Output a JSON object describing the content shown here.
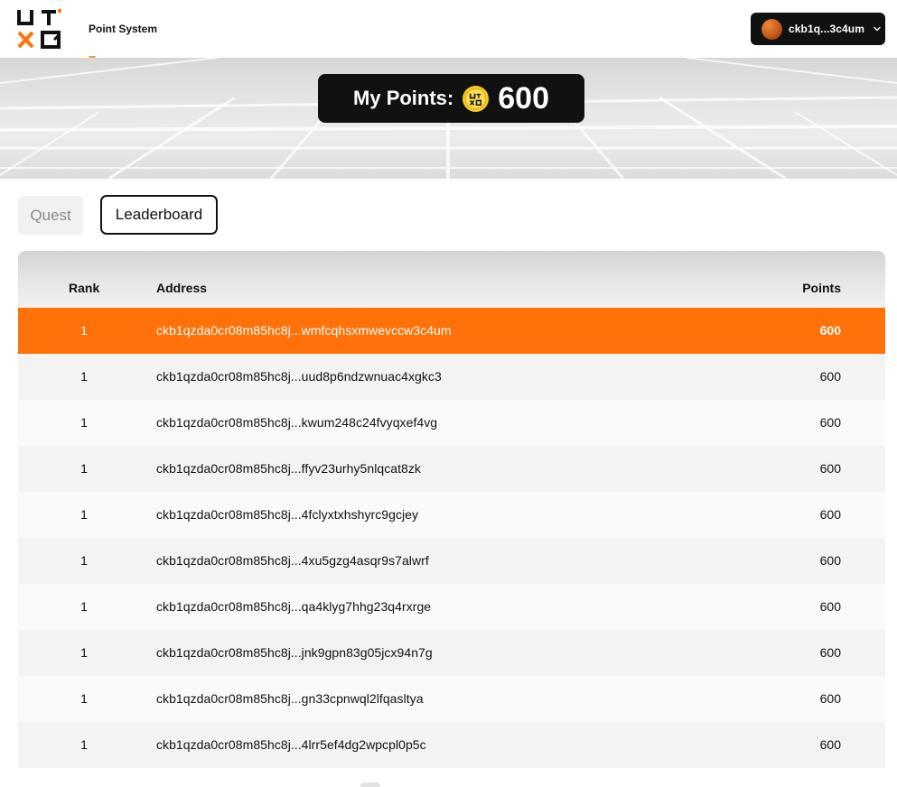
{
  "header": {
    "logo_text": "UTXO",
    "app_name": "Point System",
    "wallet_address": "ckb1q...3c4um"
  },
  "hero": {
    "points_label": "My Points:",
    "points_value": "600"
  },
  "tabs": [
    {
      "label": "Quest",
      "active": false
    },
    {
      "label": "Leaderboard",
      "active": true
    }
  ],
  "table": {
    "columns": [
      "Rank",
      "Address",
      "Points"
    ],
    "rows": [
      {
        "rank": "1",
        "address": "ckb1qzda0cr08m85hc8j...wmfcqhsxmwevccw3c4um",
        "points": "600",
        "is_current_user": true
      },
      {
        "rank": "1",
        "address": "ckb1qzda0cr08m85hc8j...uud8p6ndzwnuac4xgkc3",
        "points": "600"
      },
      {
        "rank": "1",
        "address": "ckb1qzda0cr08m85hc8j...kwum248c24fvyqxef4vg",
        "points": "600"
      },
      {
        "rank": "1",
        "address": "ckb1qzda0cr08m85hc8j...ffyv23urhy5nlqcat8zk",
        "points": "600"
      },
      {
        "rank": "1",
        "address": "ckb1qzda0cr08m85hc8j...4fclyxtxhshyrc9gcjey",
        "points": "600"
      },
      {
        "rank": "1",
        "address": "ckb1qzda0cr08m85hc8j...4xu5gzg4asqr9s7alwrf",
        "points": "600"
      },
      {
        "rank": "1",
        "address": "ckb1qzda0cr08m85hc8j...qa4klyg7hhg23q4rxrge",
        "points": "600"
      },
      {
        "rank": "1",
        "address": "ckb1qzda0cr08m85hc8j...jnk9gpn83g05jcx94n7g",
        "points": "600"
      },
      {
        "rank": "1",
        "address": "ckb1qzda0cr08m85hc8j...gn33cpnwql2lfqasltya",
        "points": "600"
      },
      {
        "rank": "1",
        "address": "ckb1qzda0cr08m85hc8j...4lrr5ef4dg2wpcpl0p5c",
        "points": "600"
      }
    ]
  },
  "colors": {
    "accent": "#ff7109",
    "dark": "#111111",
    "coin": "#f6c924"
  },
  "icons": {
    "logo": "utxo-logo-icon",
    "avatar": "avatar",
    "dropdown": "chevron-down-icon",
    "coin": "coin-icon"
  }
}
